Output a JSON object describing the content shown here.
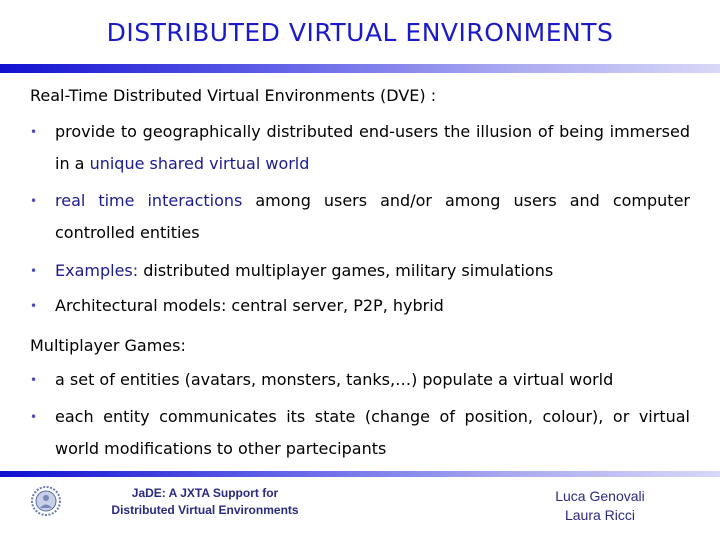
{
  "slide": {
    "title": "DISTRIBUTED VIRTUAL ENVIRONMENTS",
    "section1": {
      "heading": "Real-Time Distributed Virtual Environments (DVE) :",
      "bullets": [
        {
          "plain_pre": "provide to geographically distributed end-users the illusion of being immersed in a ",
          "highlight": "unique shared virtual world",
          "plain_post": ""
        },
        {
          "plain_pre": "",
          "highlight": "real time interactions",
          "plain_post": " among users and/or among users and computer controlled entities"
        },
        {
          "plain_pre": "",
          "highlight": "Examples:",
          "plain_post": " distributed multiplayer games, military simulations"
        },
        {
          "plain_pre": "Architectural models: central server, P2P, hybrid",
          "highlight": "",
          "plain_post": ""
        }
      ]
    },
    "section2": {
      "heading": "Multiplayer Games:",
      "bullets": [
        {
          "text": "a set of entities (avatars, monsters, tanks,…) populate a virtual world"
        },
        {
          "text": "each entity communicates its state (change of position, colour), or virtual world modifications to other partecipants"
        }
      ]
    },
    "bullet_glyph": "•",
    "footer": {
      "title_line1": "JaDE: A JXTA Support for",
      "title_line2": "Distributed Virtual Environments",
      "author1": "Luca Genovali",
      "author2": "Laura Ricci",
      "logo_icon": "university-seal-icon"
    },
    "colors": {
      "title": "#1a1ac8",
      "highlight": "#1c1c8c",
      "footer_text": "#2a2a80",
      "bullet": "#4a4ab8"
    }
  }
}
